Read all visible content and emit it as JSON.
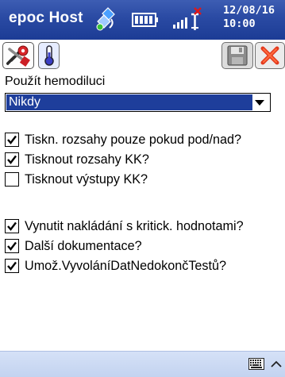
{
  "titlebar": {
    "title": "epoc Host",
    "date": "12/08/16",
    "time": "10:00",
    "icons": [
      "sync-icon",
      "battery-icon",
      "signal-no-connection-icon"
    ]
  },
  "toolbar": {
    "tabs": [
      {
        "icon": "tools-settings-icon",
        "active": true
      },
      {
        "icon": "thermometer-icon",
        "active": false
      }
    ],
    "buttons": [
      {
        "icon": "save-disk-icon",
        "enabled": false
      },
      {
        "icon": "close-x-icon",
        "enabled": true
      }
    ]
  },
  "form": {
    "hemodilution_label": "Použít hemodiluci",
    "hemodilution_value": "Nikdy",
    "checkboxes": [
      {
        "label": "Tiskn. rozsahy pouze pokud pod/nad?",
        "checked": true
      },
      {
        "label": "Tisknout rozsahy KK?",
        "checked": true
      },
      {
        "label": "Tisknout výstupy KK?",
        "checked": false
      },
      {
        "label": "Vynutit nakládání s kritick. hodnotami?",
        "checked": true
      },
      {
        "label": "Další dokumentace?",
        "checked": true
      },
      {
        "label": "Umož.VyvoláníDatNedokončTestů?",
        "checked": true
      }
    ]
  },
  "colors": {
    "titlebar": "#2a4aa3",
    "selection": "#1e3e9b",
    "bottombar": "#cfdcf5"
  },
  "bottombar": {
    "icons": [
      "keyboard-icon",
      "up-arrow-icon"
    ]
  }
}
